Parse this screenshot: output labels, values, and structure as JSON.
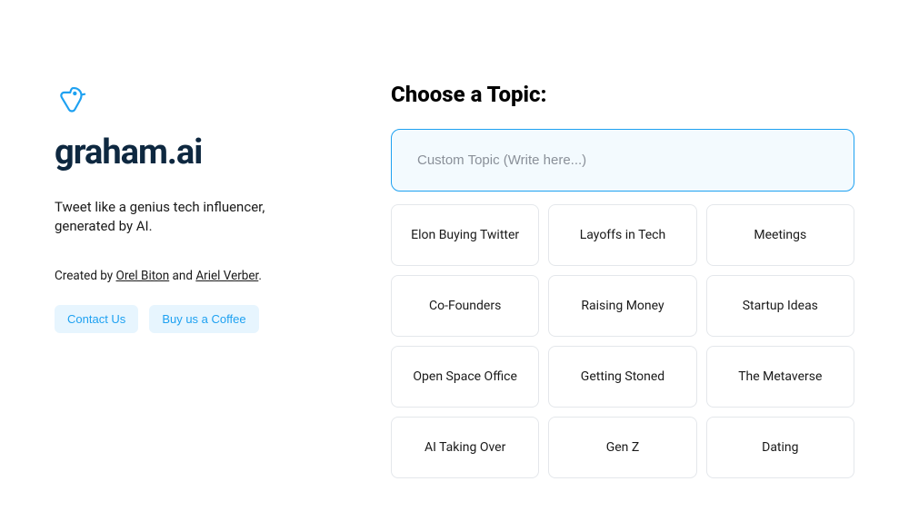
{
  "brand": {
    "name": "graham.ai",
    "tagline": "Tweet like a genius tech influencer, generated by AI."
  },
  "credits": {
    "prefix": "Created by ",
    "author1": "Orel Biton",
    "and": " and ",
    "author2": "Ariel Verber",
    "suffix": "."
  },
  "actions": {
    "contact": "Contact Us",
    "coffee": "Buy us a Coffee"
  },
  "topics": {
    "heading": "Choose a Topic:",
    "placeholder": "Custom Topic (Write here...)",
    "items": [
      "Elon Buying Twitter",
      "Layoffs in Tech",
      "Meetings",
      "Co-Founders",
      "Raising Money",
      "Startup Ideas",
      "Open Space Office",
      "Getting Stoned",
      "The Metaverse",
      "AI Taking Over",
      "Gen Z",
      "Dating"
    ]
  },
  "colors": {
    "accent": "#1ea1f1",
    "accentLight": "#e7f5fe",
    "inputBg": "#f3fafe",
    "border": "#e4e7eb",
    "logoDark": "#0e2840"
  }
}
